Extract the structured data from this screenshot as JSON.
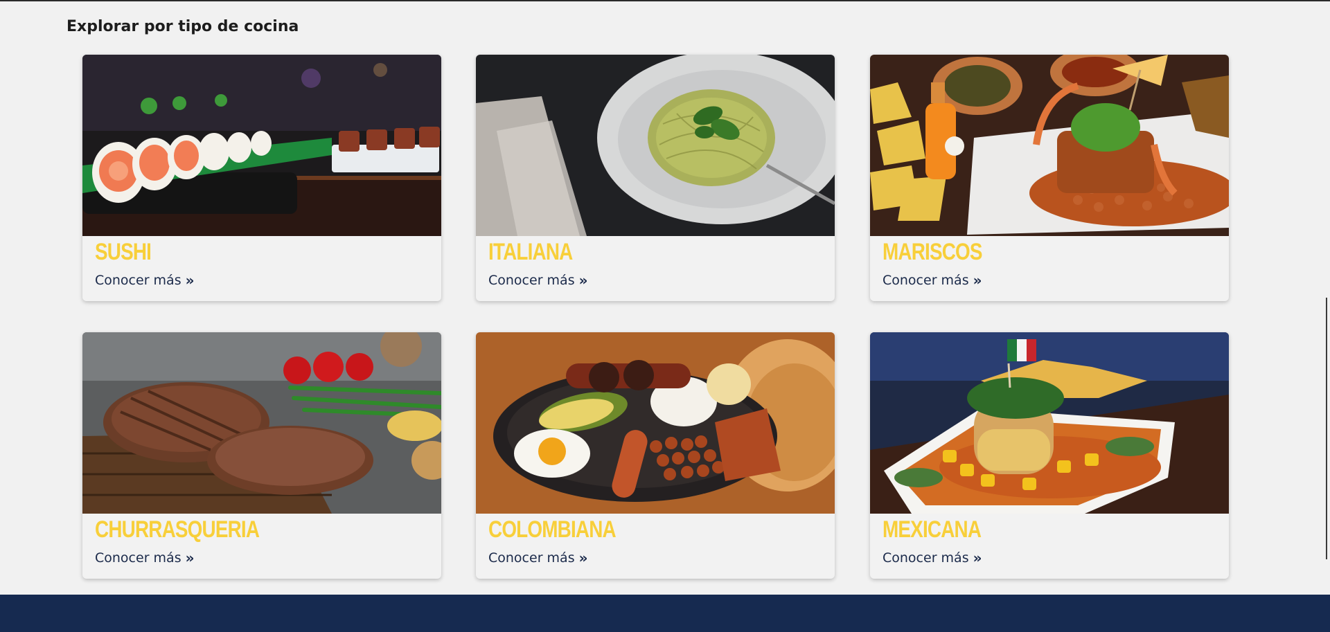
{
  "section": {
    "title": "Explorar por tipo de cocina"
  },
  "cards": [
    {
      "title": "SUSHI",
      "link": "Conocer más",
      "icon": "double-chevron-right-icon"
    },
    {
      "title": "ITALIANA",
      "link": "Conocer más",
      "icon": "double-chevron-right-icon"
    },
    {
      "title": "MARISCOS",
      "link": "Conocer más",
      "icon": "double-chevron-right-icon"
    },
    {
      "title": "CHURRASQUERIA",
      "link": "Conocer más",
      "icon": "double-chevron-right-icon"
    },
    {
      "title": "COLOMBIANA",
      "link": "Conocer más",
      "icon": "double-chevron-right-icon"
    },
    {
      "title": "MEXICANA",
      "link": "Conocer más",
      "icon": "double-chevron-right-icon"
    }
  ],
  "colors": {
    "title": "#f8cf3a",
    "link": "#1b2a4a",
    "footer": "#162a50",
    "background": "#f1f1f1"
  }
}
